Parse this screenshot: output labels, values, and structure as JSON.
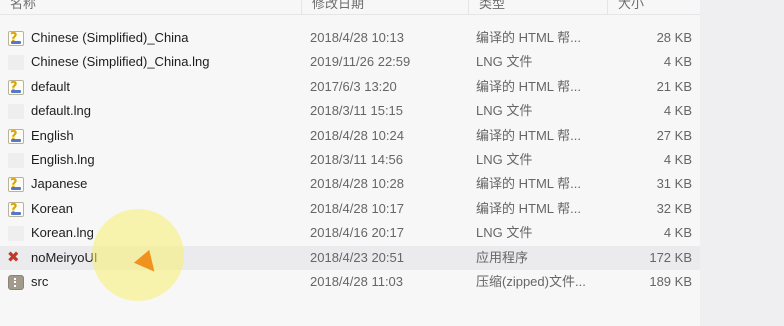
{
  "columns": {
    "name": "名称",
    "date": "修改日期",
    "type": "类型",
    "size": "大小"
  },
  "files": [
    {
      "icon": "html-help-icon",
      "name": "Chinese (Simplified)_China",
      "date": "2018/4/28 10:13",
      "type": "编译的 HTML 帮...",
      "size": "28 KB"
    },
    {
      "icon": "lng-file-icon",
      "name": "Chinese (Simplified)_China.lng",
      "date": "2019/11/26 22:59",
      "type": "LNG 文件",
      "size": "4 KB"
    },
    {
      "icon": "html-help-icon",
      "name": "default",
      "date": "2017/6/3 13:20",
      "type": "编译的 HTML 帮...",
      "size": "21 KB"
    },
    {
      "icon": "lng-file-icon",
      "name": "default.lng",
      "date": "2018/3/11 15:15",
      "type": "LNG 文件",
      "size": "4 KB"
    },
    {
      "icon": "html-help-icon",
      "name": "English",
      "date": "2018/4/28 10:24",
      "type": "编译的 HTML 帮...",
      "size": "27 KB"
    },
    {
      "icon": "lng-file-icon",
      "name": "English.lng",
      "date": "2018/3/11 14:56",
      "type": "LNG 文件",
      "size": "4 KB"
    },
    {
      "icon": "html-help-icon",
      "name": "Japanese",
      "date": "2018/4/28 10:28",
      "type": "编译的 HTML 帮...",
      "size": "31 KB"
    },
    {
      "icon": "html-help-icon",
      "name": "Korean",
      "date": "2018/4/28 10:17",
      "type": "编译的 HTML 帮...",
      "size": "32 KB"
    },
    {
      "icon": "lng-file-icon",
      "name": "Korean.lng",
      "date": "2018/4/16 20:17",
      "type": "LNG 文件",
      "size": "4 KB"
    },
    {
      "icon": "application-icon",
      "name": "noMeiryoUI",
      "date": "2018/4/23 20:51",
      "type": "应用程序",
      "size": "172 KB",
      "hovered": true
    },
    {
      "icon": "zip-archive-icon",
      "name": "src",
      "date": "2018/4/28 11:03",
      "type": "压缩(zipped)文件...",
      "size": "189 KB"
    }
  ]
}
